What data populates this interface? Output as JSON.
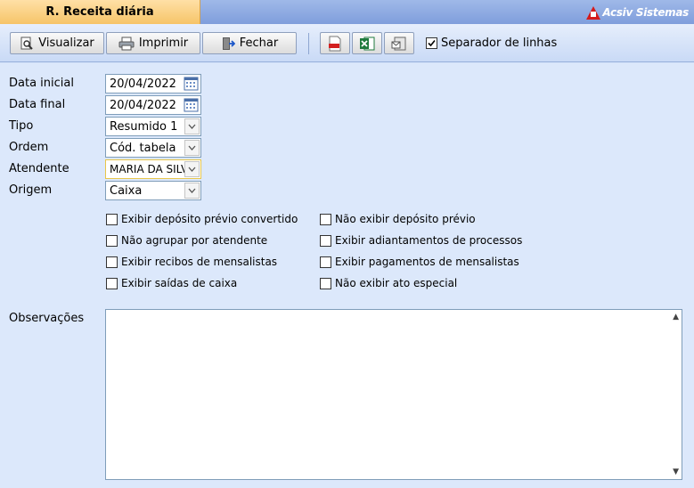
{
  "window": {
    "title": "R. Receita diária",
    "brand": "Acsiv Sistemas"
  },
  "toolbar": {
    "visualizar": "Visualizar",
    "imprimir": "Imprimir",
    "fechar": "Fechar",
    "pdf_icon": "pdf-icon",
    "excel_icon": "excel-icon",
    "email_icon": "email-icon",
    "separador_label": "Separador de linhas",
    "separador_checked": true
  },
  "form": {
    "data_inicial": {
      "label": "Data inicial",
      "value": "20/04/2022"
    },
    "data_final": {
      "label": "Data final",
      "value": "20/04/2022"
    },
    "tipo": {
      "label": "Tipo",
      "value": "Resumido 1"
    },
    "ordem": {
      "label": "Ordem",
      "value": "Cód. tabela"
    },
    "atendente": {
      "label": "Atendente",
      "value": "MARIA DA SILVA"
    },
    "origem": {
      "label": "Origem",
      "value": "Caixa"
    }
  },
  "options": {
    "left": [
      {
        "label": "Exibir depósito prévio convertido",
        "checked": false
      },
      {
        "label": "Não agrupar por atendente",
        "checked": false
      },
      {
        "label": "Exibir recibos de mensalistas",
        "checked": false
      },
      {
        "label": "Exibir saídas de caixa",
        "checked": false
      }
    ],
    "right": [
      {
        "label": "Não exibir depósito prévio",
        "checked": false
      },
      {
        "label": "Exibir adiantamentos de processos",
        "checked": false
      },
      {
        "label": "Exibir pagamentos de mensalistas",
        "checked": false
      },
      {
        "label": "Não exibir ato especial",
        "checked": false
      }
    ]
  },
  "observacoes": {
    "label": "Observações",
    "value": ""
  }
}
